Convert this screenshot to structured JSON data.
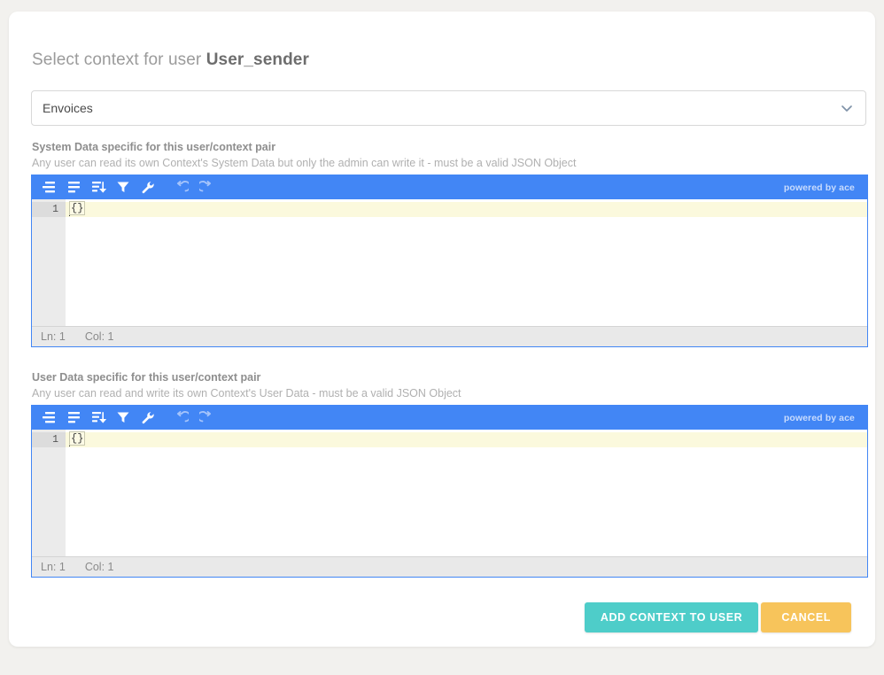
{
  "page": {
    "title_prefix": "Select context for user",
    "user_name": "User_sender"
  },
  "context_select": {
    "name": "context-select",
    "selected": "Envoices",
    "icon": "chevron-down-icon"
  },
  "sections": [
    {
      "key": "system_data",
      "label": "System Data specific for this user/context pair",
      "description": "Any user can read its own Context's System Data but only the admin can write it - must be a valid JSON Object",
      "editor": {
        "brand": "powered by ace",
        "line_number": "1",
        "content": "{}",
        "status_ln": "Ln: 1",
        "status_col": "Col: 1"
      }
    },
    {
      "key": "user_data",
      "label": "User Data specific for this user/context pair",
      "description": "Any user can read and write its own Context's User Data - must be a valid JSON Object",
      "editor": {
        "brand": "powered by ace",
        "line_number": "1",
        "content": "{}",
        "status_ln": "Ln: 1",
        "status_col": "Col: 1"
      }
    }
  ],
  "toolbar_icons": [
    {
      "name": "format-json-icon",
      "disabled": false
    },
    {
      "name": "compact-json-icon",
      "disabled": false
    },
    {
      "name": "sort-icon",
      "disabled": false
    },
    {
      "name": "filter-icon",
      "disabled": false
    },
    {
      "name": "transform-wrench-icon",
      "disabled": false
    },
    {
      "name": "undo-icon",
      "disabled": true
    },
    {
      "name": "redo-icon",
      "disabled": true
    }
  ],
  "footer": {
    "submit_label": "ADD CONTEXT TO USER",
    "cancel_label": "CANCEL"
  },
  "colors": {
    "accent_blue": "#4286f5",
    "primary_teal": "#4ecdc9",
    "cancel_amber": "#f7c45b",
    "page_bg": "#f2f1ee"
  }
}
